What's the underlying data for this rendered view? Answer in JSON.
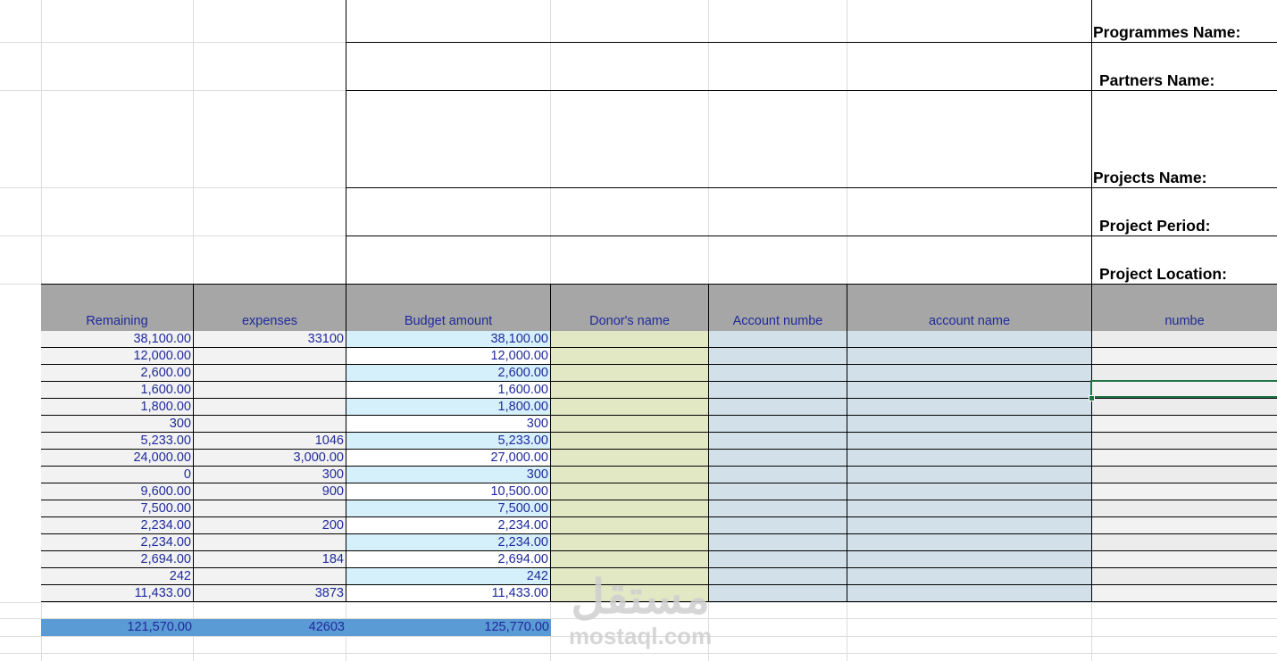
{
  "info_labels": {
    "programmes": "Programmes Name:",
    "partners": "Partners Name:",
    "projects": "Projects Name:",
    "period": "Project Period:",
    "location": "Project Location:"
  },
  "table": {
    "headers": {
      "remaining": "Remaining",
      "expenses": "expenses",
      "budget": "Budget amount",
      "donor": "Donor's name",
      "account_number": "Account numbe",
      "account_name": "account name",
      "number": "numbe"
    },
    "rows": [
      {
        "remaining": "38,100.00",
        "expenses": "33100",
        "budget": "38,100.00"
      },
      {
        "remaining": "12,000.00",
        "expenses": "",
        "budget": "12,000.00"
      },
      {
        "remaining": "2,600.00",
        "expenses": "",
        "budget": "2,600.00"
      },
      {
        "remaining": "1,600.00",
        "expenses": "",
        "budget": "1,600.00"
      },
      {
        "remaining": "1,800.00",
        "expenses": "",
        "budget": "1,800.00"
      },
      {
        "remaining": "300",
        "expenses": "",
        "budget": "300"
      },
      {
        "remaining": "5,233.00",
        "expenses": "1046",
        "budget": "5,233.00"
      },
      {
        "remaining": "24,000.00",
        "expenses": "3,000.00",
        "budget": "27,000.00"
      },
      {
        "remaining": "0",
        "expenses": "300",
        "budget": "300"
      },
      {
        "remaining": "9,600.00",
        "expenses": "900",
        "budget": "10,500.00"
      },
      {
        "remaining": "7,500.00",
        "expenses": "",
        "budget": "7,500.00"
      },
      {
        "remaining": "2,234.00",
        "expenses": "200",
        "budget": "2,234.00"
      },
      {
        "remaining": "2,234.00",
        "expenses": "",
        "budget": "2,234.00"
      },
      {
        "remaining": "2,694.00",
        "expenses": "184",
        "budget": "2,694.00"
      },
      {
        "remaining": "242",
        "expenses": "",
        "budget": "242"
      },
      {
        "remaining": "11,433.00",
        "expenses": "3873",
        "budget": "11,433.00"
      }
    ],
    "totals": {
      "remaining": "121,570.00",
      "expenses": "42603",
      "budget": "125,770.00"
    }
  },
  "watermark": {
    "logo": "مستقل",
    "text": "mostaql.com"
  },
  "colors": {
    "header_fill": "#a6a6a6",
    "donor_fill": "#e2e7c4",
    "account_fill": "#d2e1e9",
    "budget_alt_fill": "#d6f0fb",
    "total_fill": "#5b9bd5",
    "text_blue": "#1f2a9a",
    "selection": "#217346"
  }
}
